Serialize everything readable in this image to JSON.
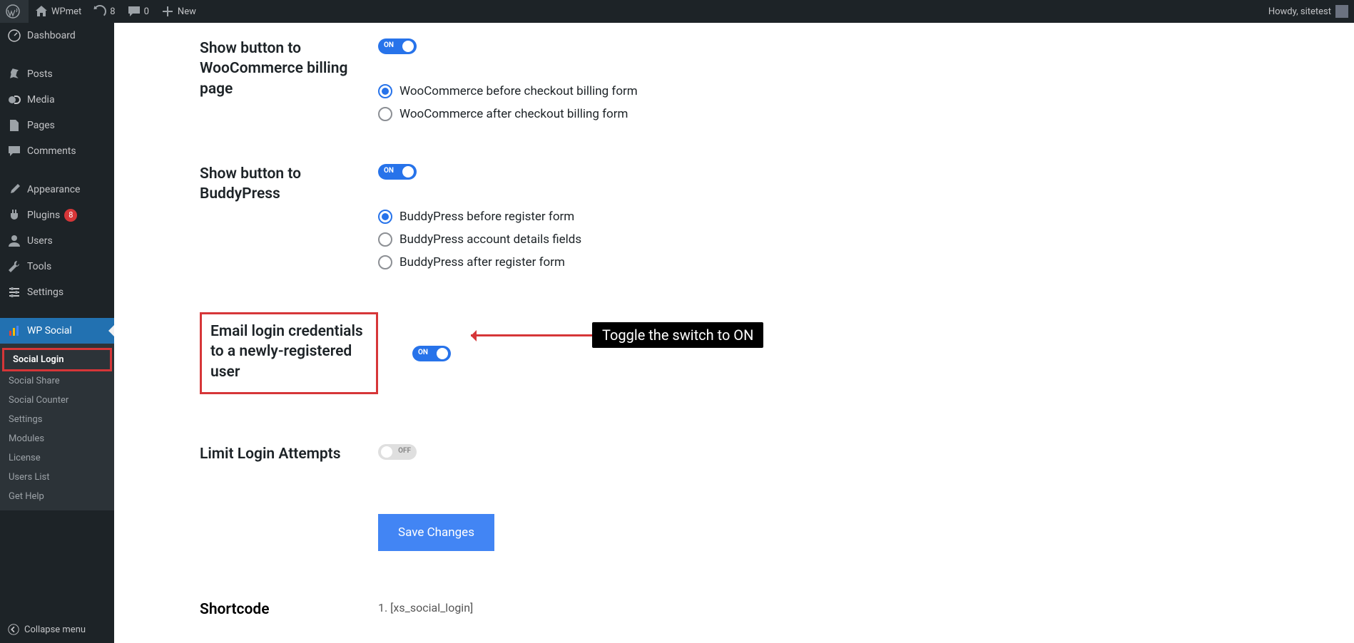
{
  "adminbar": {
    "site_name": "WPmet",
    "updates": "8",
    "comments": "0",
    "new": "New",
    "greeting": "Howdy, sitetest"
  },
  "sidebar": {
    "dashboard": "Dashboard",
    "posts": "Posts",
    "media": "Media",
    "pages": "Pages",
    "comments": "Comments",
    "appearance": "Appearance",
    "plugins": "Plugins",
    "plugins_badge": "8",
    "users": "Users",
    "tools": "Tools",
    "settings": "Settings",
    "wp_social": "WP Social",
    "submenu": {
      "social_login": "Social Login",
      "social_share": "Social Share",
      "social_counter": "Social Counter",
      "settings": "Settings",
      "modules": "Modules",
      "license": "License",
      "users_list": "Users List",
      "get_help": "Get Help"
    },
    "collapse": "Collapse menu"
  },
  "settings": {
    "woo_billing": {
      "label": "Show button to WooCommerce billing page",
      "toggle": "ON",
      "options": {
        "before": "WooCommerce before checkout billing form",
        "after": "WooCommerce after checkout billing form"
      }
    },
    "buddypress": {
      "label": "Show button to BuddyPress",
      "toggle": "ON",
      "options": {
        "before": "BuddyPress before register form",
        "account": "BuddyPress account details fields",
        "after": "BuddyPress after register form"
      }
    },
    "email_creds": {
      "label": "Email login credentials to a newly-registered user",
      "toggle": "ON"
    },
    "limit_login": {
      "label": "Limit Login Attempts",
      "toggle": "OFF"
    },
    "save": "Save Changes",
    "shortcode": {
      "label": "Shortcode",
      "value": "1. [xs_social_login]"
    }
  },
  "annotation": "Toggle the switch to ON"
}
